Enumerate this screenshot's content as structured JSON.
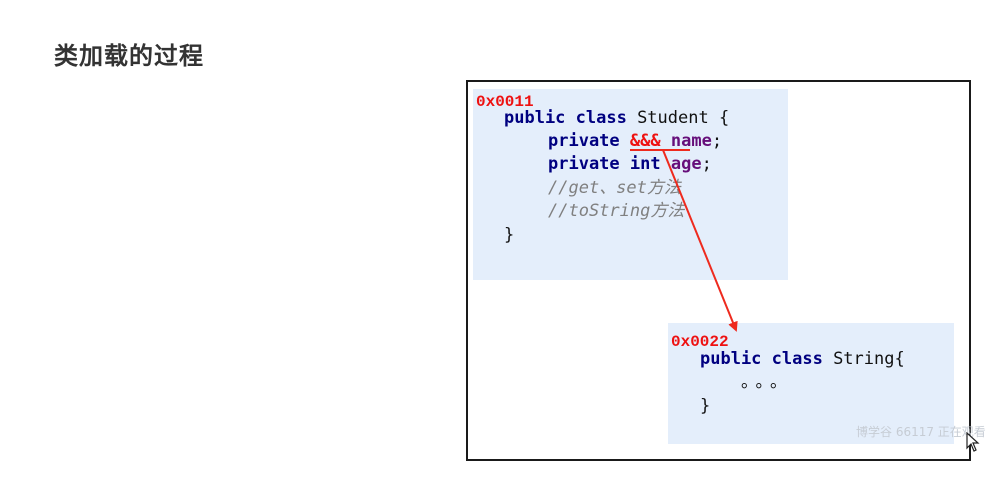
{
  "slide": {
    "title": "类加载的过程"
  },
  "student_box": {
    "address": "0x0011",
    "line1": {
      "kw": "public class",
      "name": " Student {"
    },
    "line2": {
      "kw": "private",
      "ref": "&&&",
      "field": "name",
      "end": ";"
    },
    "line3": {
      "kw": "private int",
      "field": "age",
      "end": ";"
    },
    "comment1": "//get、set方法",
    "comment2": "//toString方法",
    "close": "}"
  },
  "string_box": {
    "address": "0x0022",
    "line1": {
      "kw": "public class",
      "name": " String{"
    },
    "dots": "。。。",
    "close": "}"
  },
  "watermark": {
    "text": "博学谷 66117 正在观看"
  },
  "colors": {
    "arrow": "#ee2a1e",
    "box_fill": "#e4eefb",
    "keyword": "#000080",
    "field": "#660e7a",
    "address": "#ee1111"
  }
}
